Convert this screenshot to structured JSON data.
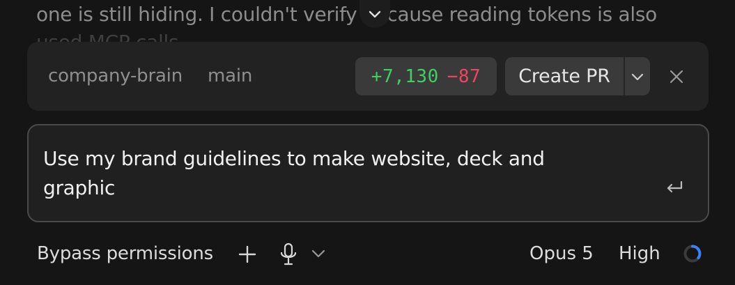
{
  "transcript": {
    "line1": "one is still hiding. I couldn't verify because reading tokens is also",
    "line2": "used MCP calls"
  },
  "scroll_button": {
    "icon": "chevron-down-icon"
  },
  "branch_bar": {
    "repo": "company-brain",
    "branch": "main",
    "additions": "+7,130",
    "deletions": "−87",
    "create_pr_label": "Create PR",
    "addition_color": "#3fcf62",
    "deletion_color": "#ef4660"
  },
  "prompt": {
    "text": "Use my brand guidelines to make website, deck and graphic"
  },
  "toolbar": {
    "permissions_label": "Bypass permissions",
    "model_label": "Opus 5",
    "effort_label": "High"
  },
  "colors": {
    "background": "#151515",
    "panel": "#222222",
    "accent_ring": "#3b82f6"
  }
}
